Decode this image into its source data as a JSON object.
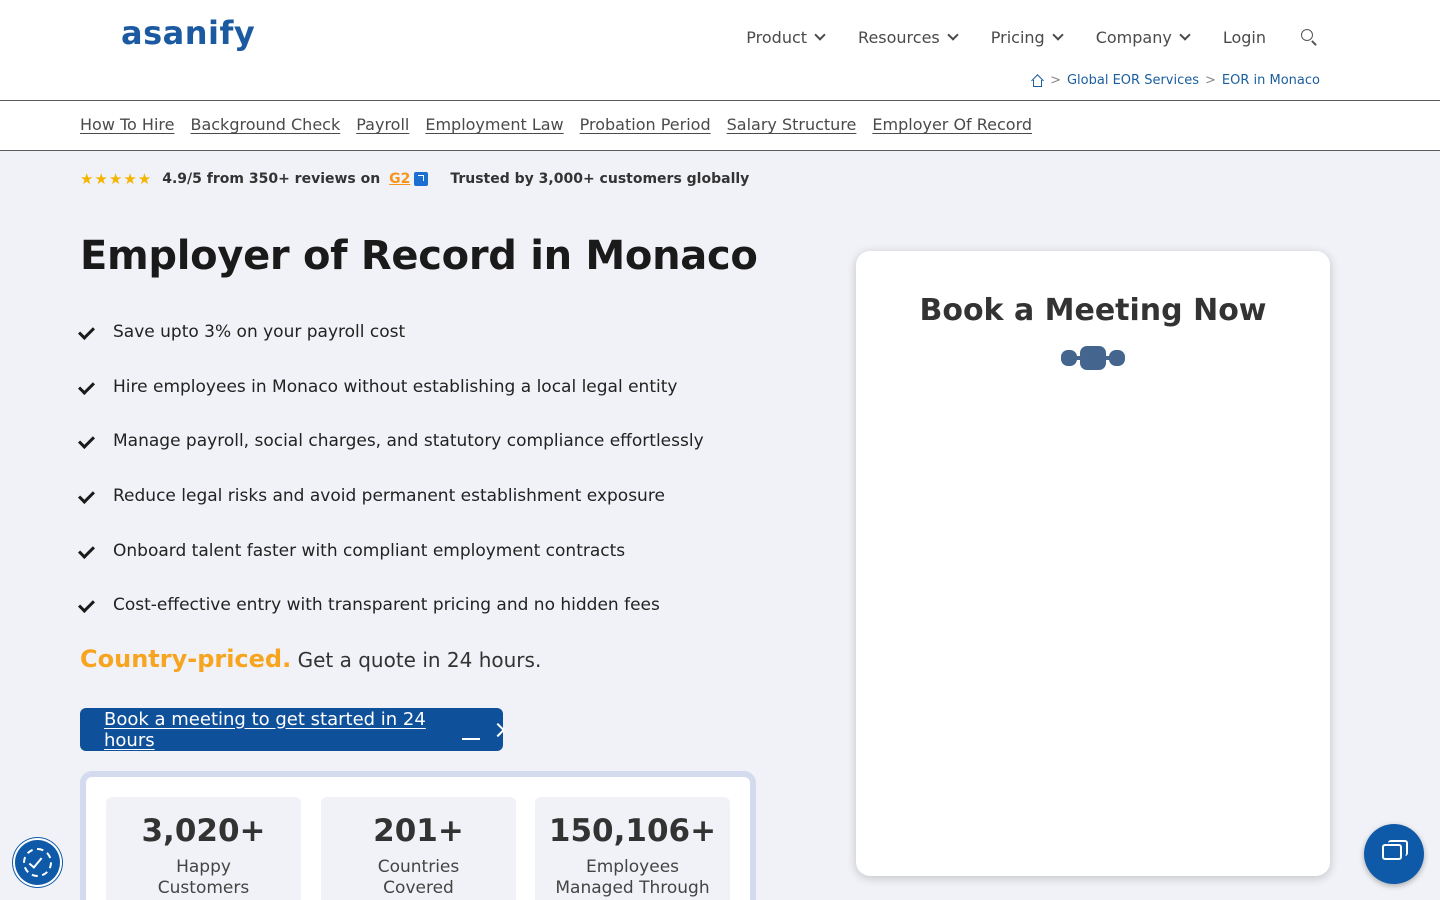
{
  "header": {
    "logo": "asanify",
    "nav": [
      {
        "label": "Product",
        "has_dropdown": true
      },
      {
        "label": "Resources",
        "has_dropdown": true
      },
      {
        "label": "Pricing",
        "has_dropdown": true
      },
      {
        "label": "Company",
        "has_dropdown": true
      },
      {
        "label": "Login",
        "has_dropdown": false
      }
    ],
    "search_icon": "search-icon"
  },
  "breadcrumb": {
    "home_icon": "home-icon",
    "separator": ">",
    "items": [
      "Global EOR Services",
      "EOR in Monaco"
    ]
  },
  "subnav": {
    "links": [
      "How To Hire",
      "Background Check",
      "Payroll",
      "Employment Law",
      "Probation Period",
      "Salary Structure",
      "Employer Of Record"
    ]
  },
  "rating": {
    "stars": "★★★★★",
    "score": "4.9/5",
    "from_text": " from 350+ reviews on ",
    "g2": "G2",
    "trusted": "Trusted by 3,000+ customers globally"
  },
  "hero": {
    "title": "Employer of Record in Monaco",
    "features": [
      "Save upto 3% on your payroll cost",
      "Hire employees in Monaco without establishing a local legal entity",
      "Manage payroll, social charges, and statutory compliance effortlessly",
      "Reduce legal risks and avoid permanent establishment exposure",
      "Onboard talent faster with compliant employment contracts",
      "Cost-effective entry with transparent pricing and no hidden fees"
    ],
    "priced_highlight": "Country-priced.",
    "priced_text": " Get a quote in 24 hours.",
    "cta_label": "Book a meeting to get started in 24 hours"
  },
  "stats": [
    {
      "value": "3,020+",
      "label": "Happy Customers Globally"
    },
    {
      "value": "201+",
      "label": "Countries Covered"
    },
    {
      "value": "150,106+",
      "label": "Employees Managed Through"
    }
  ],
  "meeting": {
    "title": "Book a Meeting Now"
  },
  "colors": {
    "brand_blue": "#0f509a",
    "accent_orange": "#f7a520",
    "page_bg": "#f1f2f7"
  }
}
